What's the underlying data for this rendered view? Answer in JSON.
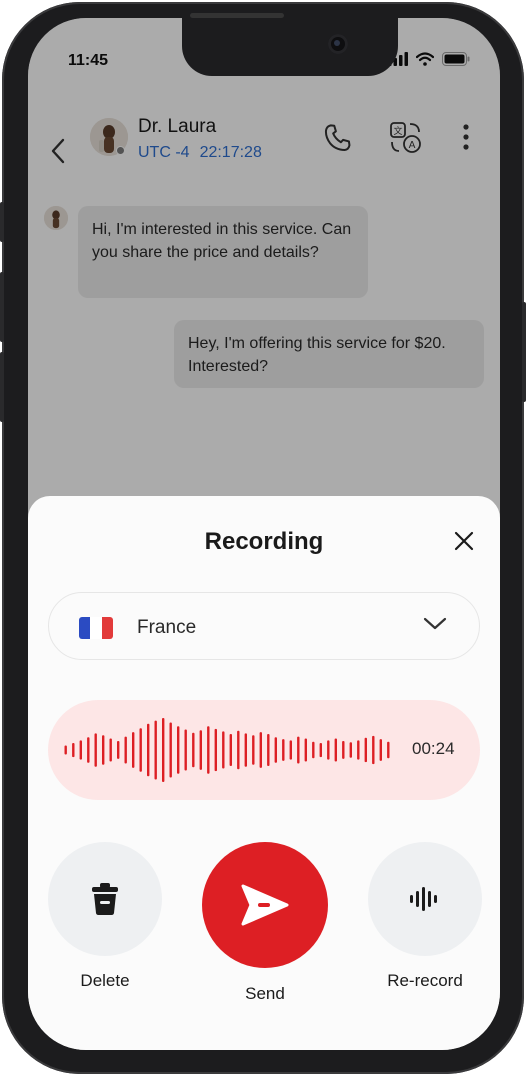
{
  "status_bar": {
    "time": "11:45"
  },
  "chat": {
    "contact_name": "Dr. Laura",
    "timezone": "UTC -4",
    "local_time": "22:17:28",
    "messages": [
      {
        "direction": "incoming",
        "text": "Hi, I'm interested in this service. Can you share the price and details?"
      },
      {
        "direction": "outgoing",
        "text": "Hey, I'm offering this service for $20. Interested?"
      }
    ]
  },
  "recording_sheet": {
    "title": "Recording",
    "language": {
      "selected": "France",
      "flag_colors": [
        "#2b4bc2",
        "#ffffff",
        "#e23a3a"
      ]
    },
    "duration": "00:24",
    "waveform_levels": [
      0.14,
      0.22,
      0.3,
      0.4,
      0.52,
      0.46,
      0.36,
      0.28,
      0.42,
      0.56,
      0.68,
      0.82,
      0.92,
      1.0,
      0.86,
      0.74,
      0.64,
      0.54,
      0.62,
      0.74,
      0.66,
      0.58,
      0.5,
      0.6,
      0.52,
      0.46,
      0.56,
      0.5,
      0.4,
      0.34,
      0.3,
      0.42,
      0.36,
      0.26,
      0.22,
      0.3,
      0.36,
      0.28,
      0.24,
      0.3,
      0.38,
      0.44,
      0.34,
      0.26
    ],
    "actions": {
      "delete_label": "Delete",
      "send_label": "Send",
      "rerecord_label": "Re-record"
    },
    "colors": {
      "accent": "#dd1f24",
      "waveform_bg": "#fde6e6",
      "timezone_blue": "#2f6fd1"
    }
  }
}
